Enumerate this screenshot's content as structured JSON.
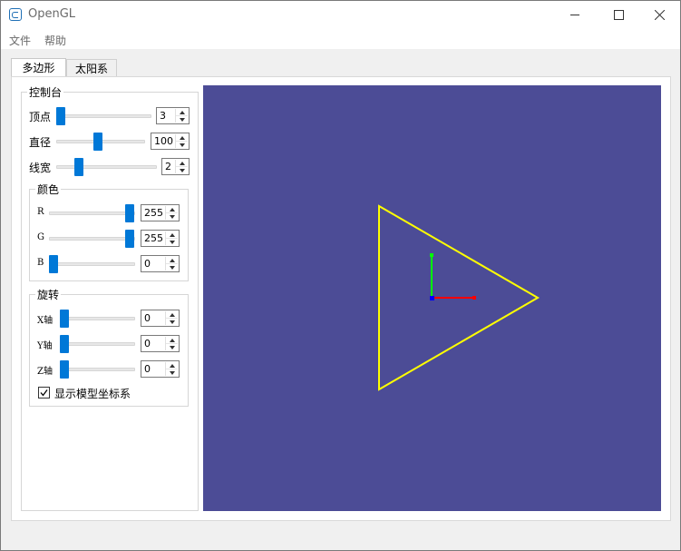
{
  "window": {
    "title": "OpenGL",
    "app_icon": "qt-creator-icon"
  },
  "title_buttons": {
    "minimize": "minimize-icon",
    "maximize": "maximize-icon",
    "close": "close-icon"
  },
  "menu": {
    "items": [
      "文件",
      "帮助"
    ]
  },
  "tabs": [
    {
      "label": "多边形",
      "active": true
    },
    {
      "label": "太阳系",
      "active": false
    }
  ],
  "console": {
    "title": "控制台",
    "vertices": {
      "label": "顶点",
      "value": "3",
      "slider_fraction": 0.0
    },
    "diameter": {
      "label": "直径",
      "value": "100",
      "slider_fraction": 0.45
    },
    "line_width": {
      "label": "线宽",
      "value": "2",
      "slider_fraction": 0.2
    }
  },
  "color": {
    "title": "颜色",
    "r": {
      "label": "R",
      "value": "255",
      "slider_fraction": 1.0
    },
    "g": {
      "label": "G",
      "value": "255",
      "slider_fraction": 1.0
    },
    "b": {
      "label": "B",
      "value": "0",
      "slider_fraction": 0.0
    }
  },
  "rotation": {
    "title": "旋转",
    "x": {
      "label": "X轴",
      "value": "0",
      "slider_fraction": 0.0
    },
    "y": {
      "label": "Y轴",
      "value": "0",
      "slider_fraction": 0.0
    },
    "z": {
      "label": "Z轴",
      "value": "0",
      "slider_fraction": 0.0
    }
  },
  "show_axes": {
    "label": "显示模型坐标系",
    "checked": true
  },
  "colors": {
    "canvas_bg": "#4c4c96",
    "polygon": "#ffff00",
    "axis_x": "#ff0000",
    "axis_y": "#00ff00",
    "axis_z": "#0000ff",
    "accent": "#0078d7"
  }
}
